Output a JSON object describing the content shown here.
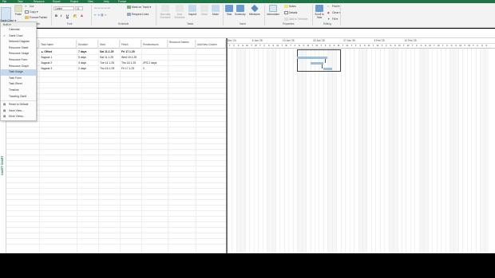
{
  "ribbon_tabs": [
    "File",
    "Task",
    "Resource",
    "Report",
    "Project",
    "View",
    "Help",
    "Format"
  ],
  "ribbon": {
    "gantt_chart_label": "Gantt Chart ▾",
    "paste_label": "Paste",
    "cut_label": "Cut",
    "copy_label": "Copy ▾",
    "format_painter_label": "Format Painter",
    "font_name": "Calibri",
    "font_size": "11",
    "font_group": "Font",
    "clipboard_group": "Clipboard",
    "mark_on_track": "Mark on Track ▾",
    "respect_links": "Respect Links",
    "schedule_group": "Schedule",
    "manually_schedule": "Manually Schedule",
    "auto_schedule": "Auto Schedule",
    "tasks_group": "Tasks",
    "inspect": "Inspect",
    "move": "Move",
    "mode": "Mode",
    "task": "Task",
    "summary": "Summary",
    "milestone": "Milestone",
    "insert_group": "Insert",
    "information": "Information",
    "notes": "Notes",
    "details": "Details",
    "add_to_timeline": "Add to Timeline",
    "properties_group": "Properties",
    "scroll_to_task": "Scroll to Task",
    "find": "Find ▾",
    "clear": "Clear ▾",
    "fill": "Fill ▾",
    "editing_group": "Editing"
  },
  "view_menu": {
    "header": "Built-In",
    "items": [
      {
        "label": "Calendar",
        "checked": false,
        "active": false
      },
      {
        "label": "Gantt Chart",
        "checked": true,
        "active": false
      },
      {
        "label": "Network Diagram",
        "checked": false,
        "active": false
      },
      {
        "label": "Resource Sheet",
        "checked": false,
        "active": false
      },
      {
        "label": "Resource Usage",
        "checked": false,
        "active": false
      },
      {
        "label": "Resource Form",
        "checked": false,
        "active": false
      },
      {
        "label": "Resource Graph",
        "checked": false,
        "active": false
      },
      {
        "label": "Task Usage",
        "checked": false,
        "active": true
      },
      {
        "label": "Task Form",
        "checked": false,
        "active": false
      },
      {
        "label": "Task Sheet",
        "checked": false,
        "active": false
      },
      {
        "label": "Timeline",
        "checked": false,
        "active": false
      },
      {
        "label": "Tracking Gantt",
        "checked": false,
        "active": false
      }
    ],
    "reset_to_default": "Reset to Default",
    "save_view": "Save View...",
    "more_views": "More Views..."
  },
  "grid": {
    "headers": {
      "task_name": "Task Name",
      "duration": "Duration",
      "start": "Start",
      "finish": "Finish",
      "predecessors": "Predecessors",
      "resource_names": "Resource Names",
      "add_new_column": "Add New Column"
    },
    "rows": [
      {
        "name": "▲ Offset",
        "duration": "7 days",
        "start": "Sat 11.1.25",
        "finish": "Fri 17.1.25",
        "pred": "",
        "summary": true
      },
      {
        "name": "Задача 1",
        "duration": "5 days",
        "start": "Sat 11.1.25",
        "finish": "Wed 15.1.25",
        "pred": "",
        "summary": false
      },
      {
        "name": "Задача 2",
        "duration": "3 days",
        "start": "Tue 14.1.25",
        "finish": "Thu 16.1.25",
        "pred": "2FS-2 days",
        "summary": false
      },
      {
        "name": "Задача 3",
        "duration": "2 days",
        "start": "Thu 16.1.25",
        "finish": "Fri 17.1.25",
        "pred": "2",
        "summary": false
      }
    ]
  },
  "timescale": {
    "weeks": [
      "Dec '24",
      "6 Jan '25",
      "13 Jan '25",
      "20 Jan '25",
      "27 Jan '25",
      "3 Feb '25",
      "10 Feb '25"
    ],
    "day_letters": [
      "T",
      "F",
      "S",
      "S",
      "M",
      "T",
      "W",
      "T",
      "F",
      "S",
      "S",
      "M",
      "T",
      "W",
      "T",
      "F",
      "S",
      "S",
      "M",
      "T",
      "W",
      "T",
      "F",
      "S",
      "S",
      "M",
      "T",
      "W",
      "T",
      "F",
      "S",
      "S",
      "M",
      "T",
      "W",
      "T",
      "F",
      "S",
      "S",
      "M",
      "T",
      "W",
      "T",
      "F",
      "S",
      "S",
      "M",
      "T",
      "W",
      "T",
      "F",
      "S",
      "S",
      "M",
      "T",
      "W",
      "T",
      "F",
      "S",
      "S"
    ]
  },
  "side_label": "GANTT CHART",
  "colors": {
    "accent": "#227447",
    "bar": "#9cbfe0",
    "active_menu": "#c5d9ee"
  }
}
